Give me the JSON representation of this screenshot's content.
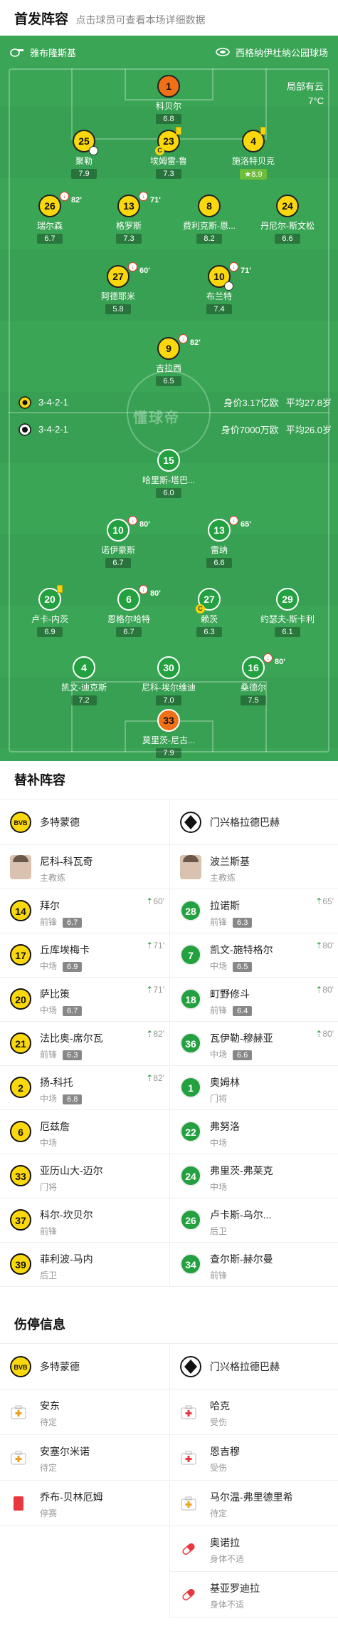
{
  "header": {
    "title": "首发阵容",
    "subtitle": "点击球员可查看本场详细数据"
  },
  "top_team": {
    "name": "雅布隆斯基",
    "stadium": "西格纳伊杜纳公园球场"
  },
  "weather": {
    "condition": "局部有云",
    "temp": "7°C"
  },
  "dortmund_info": {
    "formation": "3-4-2-1",
    "value": "身价3.17亿欧",
    "age": "平均27.8岁"
  },
  "gladbach_info": {
    "formation": "3-4-2-1",
    "value": "身价7000万欧",
    "age": "平均26.0岁"
  },
  "watermark": "懂球帝",
  "players": [
    {
      "num": "1",
      "name": "科贝尔",
      "rating": "6.8"
    },
    {
      "num": "25",
      "name": "聚勒",
      "rating": "7.9"
    },
    {
      "num": "23",
      "name": "埃姆雷-鲁",
      "rating": "7.3"
    },
    {
      "num": "4",
      "name": "施洛特贝克",
      "rating": "8.9"
    },
    {
      "num": "26",
      "name": "瑞尔森",
      "rating": "6.7",
      "sub_min": "82'"
    },
    {
      "num": "13",
      "name": "格罗斯",
      "rating": "7.3",
      "sub_min": "71'"
    },
    {
      "num": "8",
      "name": "费利克斯-恩...",
      "rating": "8.2"
    },
    {
      "num": "24",
      "name": "丹尼尔-斯文松",
      "rating": "6.6"
    },
    {
      "num": "27",
      "name": "阿德耶米",
      "rating": "5.8",
      "sub_min": "60'"
    },
    {
      "num": "10",
      "name": "布兰特",
      "rating": "7.4",
      "sub_min": "71'"
    },
    {
      "num": "9",
      "name": "吉拉西",
      "rating": "6.5",
      "sub_min": "82'"
    },
    {
      "num": "15",
      "name": "哈里斯-塔巴...",
      "rating": "6.0"
    },
    {
      "num": "10",
      "name": "诺伊豪斯",
      "rating": "6.7",
      "sub_min": "80'"
    },
    {
      "num": "13",
      "name": "雷纳",
      "rating": "6.6",
      "sub_min": "65'"
    },
    {
      "num": "20",
      "name": "卢卡-内茨",
      "rating": "6.9"
    },
    {
      "num": "6",
      "name": "恩格尔哈特",
      "rating": "6.7",
      "sub_min": "80'"
    },
    {
      "num": "27",
      "name": "赖茨",
      "rating": "6.3"
    },
    {
      "num": "29",
      "name": "约瑟夫-斯卡利",
      "rating": "6.1"
    },
    {
      "num": "4",
      "name": "凯文-迪克斯",
      "rating": "7.2"
    },
    {
      "num": "30",
      "name": "尼科-埃尔维迪",
      "rating": "7.0"
    },
    {
      "num": "16",
      "name": "桑德尔",
      "rating": "7.5",
      "sub_min": "80'"
    },
    {
      "num": "33",
      "name": "莫里茨-尼古...",
      "rating": "7.9"
    }
  ],
  "cap_label": "C",
  "subs": {
    "title": "替补阵容",
    "left_team": "多特蒙德",
    "right_team": "门兴格拉德巴赫",
    "left_coach": {
      "name": "尼科-科瓦奇",
      "role": "主教练"
    },
    "right_coach": {
      "name": "波兰斯基",
      "role": "主教练"
    },
    "left": [
      {
        "num": "14",
        "name": "拜尔",
        "pos": "前锋",
        "rating": "6.7",
        "event": "60'"
      },
      {
        "num": "17",
        "name": "丘库埃梅卡",
        "pos": "中场",
        "rating": "6.9",
        "event": "71'"
      },
      {
        "num": "20",
        "name": "萨比策",
        "pos": "中场",
        "rating": "6.7",
        "event": "71'"
      },
      {
        "num": "21",
        "name": "法比奥-席尔瓦",
        "pos": "前锋",
        "rating": "6.3",
        "event": "82'"
      },
      {
        "num": "2",
        "name": "扬-科托",
        "pos": "中场",
        "rating": "6.8",
        "event": "82'"
      },
      {
        "num": "6",
        "name": "厄兹詹",
        "pos": "中场"
      },
      {
        "num": "33",
        "name": "亚历山大-迈尔",
        "pos": "门将"
      },
      {
        "num": "37",
        "name": "科尔-坎贝尔",
        "pos": "前锋"
      },
      {
        "num": "39",
        "name": "菲利波-马内",
        "pos": "后卫"
      }
    ],
    "right": [
      {
        "num": "28",
        "name": "拉诺斯",
        "pos": "前锋",
        "rating": "6.3",
        "event": "65'"
      },
      {
        "num": "7",
        "name": "凯文-施特格尔",
        "pos": "中场",
        "rating": "6.5",
        "event": "80'"
      },
      {
        "num": "18",
        "name": "町野修斗",
        "pos": "前锋",
        "rating": "6.4",
        "event": "80'"
      },
      {
        "num": "36",
        "name": "瓦伊勒-穆赫亚",
        "pos": "中场",
        "rating": "6.6",
        "event": "80'"
      },
      {
        "num": "1",
        "name": "奥姆林",
        "pos": "门将"
      },
      {
        "num": "22",
        "name": "弗努洛",
        "pos": "中场"
      },
      {
        "num": "24",
        "name": "弗里茨-弗莱克",
        "pos": "中场"
      },
      {
        "num": "26",
        "name": "卢卡斯-乌尔...",
        "pos": "后卫"
      },
      {
        "num": "34",
        "name": "查尔斯-赫尔曼",
        "pos": "前锋"
      }
    ]
  },
  "injuries": {
    "title": "伤停信息",
    "left_team": "多特蒙德",
    "right_team": "门兴格拉德巴赫",
    "left": [
      {
        "name": "安东",
        "status": "待定",
        "icon": "doubtful-icon"
      },
      {
        "name": "安塞尔米诺",
        "status": "待定",
        "icon": "doubtful-icon"
      },
      {
        "name": "乔布-贝林厄姆",
        "status": "停赛",
        "icon": "red-card-icon"
      }
    ],
    "right": [
      {
        "name": "哈克",
        "status": "受伤",
        "icon": "injury-icon"
      },
      {
        "name": "恩吉穆",
        "status": "受伤",
        "icon": "injury-icon"
      },
      {
        "name": "马尔温-弗里德里希",
        "status": "待定",
        "icon": "doubtful-icon"
      },
      {
        "name": "奥诺拉",
        "status": "身体不适",
        "icon": "illness-icon"
      },
      {
        "name": "基亚罗迪拉",
        "status": "身体不适",
        "icon": "illness-icon"
      }
    ]
  }
}
